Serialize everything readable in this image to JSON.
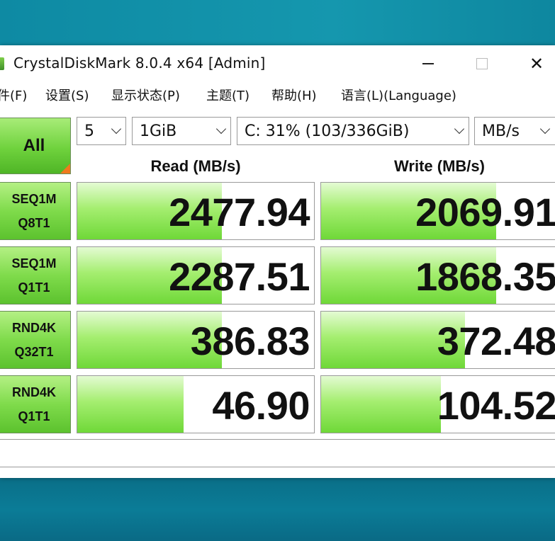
{
  "window": {
    "title": "CrystalDiskMark 8.0.4 x64 [Admin]",
    "controls": {
      "minimize": "—",
      "maximize": "□",
      "close": "✕"
    }
  },
  "menu": [
    "件(F)",
    "设置(S)",
    "显示状态(P)",
    "主题(T)",
    "帮助(H)",
    "语言(L)(Language)"
  ],
  "toolbar": {
    "all_label": "All",
    "count": "5",
    "size": "1GiB",
    "drive": "C: 31% (103/336GiB)",
    "unit": "MB/s"
  },
  "headers": {
    "read": "Read (MB/s)",
    "write": "Write (MB/s)"
  },
  "rows": [
    {
      "label1": "SEQ1M",
      "label2": "Q8T1",
      "read": "2477.94",
      "write": "2069.91",
      "read_fill_pct": 61,
      "write_fill_pct": 73
    },
    {
      "label1": "SEQ1M",
      "label2": "Q1T1",
      "read": "2287.51",
      "write": "1868.35",
      "read_fill_pct": 61,
      "write_fill_pct": 73
    },
    {
      "label1": "RND4K",
      "label2": "Q32T1",
      "read": "386.83",
      "write": "372.48",
      "read_fill_pct": 61,
      "write_fill_pct": 60
    },
    {
      "label1": "RND4K",
      "label2": "Q1T1",
      "read": "46.90",
      "write": "104.52",
      "read_fill_pct": 45,
      "write_fill_pct": 50
    }
  ],
  "colors": {
    "bar_green": "#6fd838",
    "label_green": "#7fdb4b",
    "accent_orange": "#f07a1e",
    "desktop": "#0e8aa3"
  }
}
